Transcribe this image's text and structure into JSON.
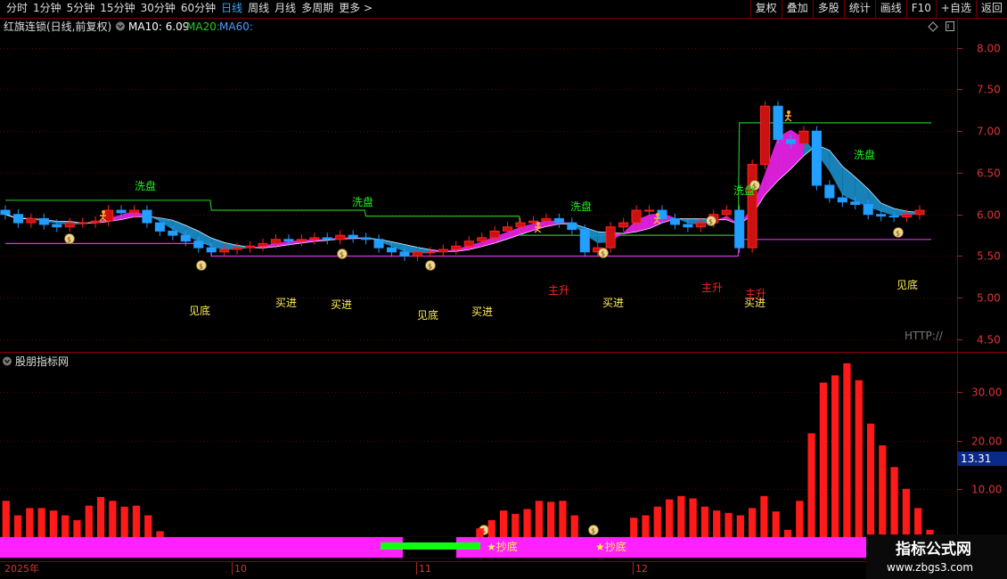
{
  "toolbar": {
    "periods": [
      "分时",
      "1分钟",
      "5分钟",
      "15分钟",
      "30分钟",
      "60分钟",
      "日线",
      "周线",
      "月线",
      "多周期",
      "更多 >"
    ],
    "active_period": "日线",
    "right_buttons": [
      "复权",
      "叠加",
      "多股",
      "统计",
      "画线",
      "F10",
      "+自选",
      "返回"
    ]
  },
  "main_panel": {
    "title": "红旗连锁(日线,前复权)",
    "ma10": "MA10: 6.09",
    "ma20": "MA20:",
    "ma60": "MA60:",
    "watermark": "HTTP://",
    "signals_green": [
      "洗盘",
      "洗盘",
      "洗盘",
      "洗盘",
      "洗盘"
    ],
    "signals_yellow": [
      "见底",
      "买进",
      "买进",
      "见底",
      "买进",
      "买进",
      "买进",
      "见底"
    ],
    "signals_red": [
      "主升",
      "主升",
      "主升"
    ],
    "colors": {
      "up": "#ff2222",
      "down": "#2299ff",
      "ma10": "#ffffff",
      "ma20": "#22bb22",
      "ma60": "#dd33dd",
      "ribbon_up": "#ee22ee",
      "ribbon_down": "#1a8fcc"
    }
  },
  "sub_panel": {
    "title": "股朋指标网",
    "current_value": "13.31",
    "signals": [
      "★抄底",
      "★抄底"
    ]
  },
  "x_axis": {
    "labels": [
      "2025年",
      "10",
      "11",
      "12"
    ]
  },
  "branding": {
    "site_name": "指标公式网",
    "site_url": "www.zbgs3.com"
  },
  "chart_data": [
    {
      "type": "candlestick",
      "title": "红旗连锁(日线,前复权)",
      "y_ticks": [
        4.5,
        5.0,
        5.5,
        6.0,
        6.5,
        7.0,
        7.5,
        8.0
      ],
      "ylim": [
        4.35,
        8.35
      ],
      "x_period_labels": [
        "2025年",
        "10",
        "11",
        "12"
      ],
      "close": [
        6.0,
        5.9,
        5.95,
        5.88,
        5.85,
        5.9,
        5.9,
        5.92,
        6.05,
        6.02,
        6.05,
        5.9,
        5.8,
        5.75,
        5.68,
        5.6,
        5.55,
        5.58,
        5.6,
        5.62,
        5.65,
        5.7,
        5.68,
        5.7,
        5.72,
        5.7,
        5.75,
        5.72,
        5.7,
        5.6,
        5.55,
        5.5,
        5.55,
        5.55,
        5.58,
        5.62,
        5.68,
        5.72,
        5.8,
        5.85,
        5.9,
        5.92,
        5.95,
        5.9,
        5.82,
        5.55,
        5.6,
        5.85,
        5.9,
        6.05,
        6.05,
        5.95,
        5.88,
        5.85,
        5.9,
        6.0,
        6.05,
        5.6,
        6.6,
        7.3,
        6.9,
        6.85,
        7.0,
        6.35,
        6.2,
        6.15,
        6.12,
        6.0,
        5.98,
        5.97,
        6.0,
        6.05
      ],
      "ma10_last": 6.09,
      "ma20_level": [
        6.17,
        6.05,
        5.98,
        5.75,
        7.1
      ],
      "ma60_level": [
        5.65,
        5.5,
        5.5,
        5.5,
        5.7
      ]
    },
    {
      "type": "bar",
      "title": "股朋指标网",
      "y_ticks": [
        10,
        20,
        30
      ],
      "ylim": [
        -5,
        38
      ],
      "values": [
        7.5,
        4.5,
        6,
        6,
        5.5,
        4.5,
        3.5,
        6.5,
        8.3,
        7.5,
        6.3,
        6.5,
        4.5,
        1.2,
        0,
        0,
        0,
        0,
        0,
        0,
        0,
        0,
        0,
        0,
        0,
        0,
        0,
        0,
        0,
        0,
        0,
        0,
        0,
        0,
        0,
        0,
        0,
        0,
        0,
        0,
        1.8,
        3.5,
        5.5,
        4.8,
        5.8,
        7.5,
        7.3,
        7.5,
        4.5,
        0,
        0,
        0,
        0,
        4,
        4.5,
        6.3,
        7.8,
        8.5,
        8,
        6.3,
        5.5,
        5,
        4.5,
        6,
        8.5,
        5.3,
        1.5,
        7.5,
        21.5,
        32,
        33.5,
        36,
        32.5,
        23.5,
        19,
        14.5,
        10,
        6,
        1.5
      ],
      "current_value": 13.31
    }
  ]
}
